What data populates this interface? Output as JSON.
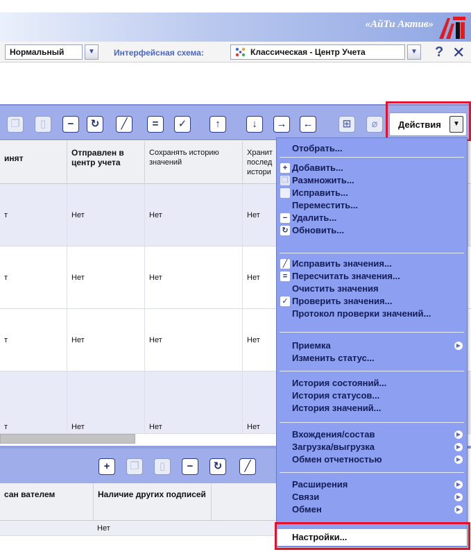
{
  "brand": {
    "name": "«АйТи Актив»"
  },
  "scheme_bar": {
    "mode": "Нормальный",
    "scheme_label": "Интерфейсная схема:",
    "scheme_value": "Классическая - Центр Учета",
    "help": "?",
    "close": "✕"
  },
  "toolbar": {
    "buttons": [
      "copy-icon",
      "new-doc-icon",
      "minus-icon",
      "refresh-icon",
      "pencil-icon",
      "equals-icon",
      "check-icon",
      "arrow-up-icon",
      "arrow-down-icon",
      "arrow-right-icon",
      "arrow-left-icon",
      "excel-icon",
      "attach-icon"
    ],
    "actions_label": "Действия"
  },
  "grid": {
    "columns": [
      "инят",
      "Отправлен в центр учета",
      "Сохранять историю значений",
      "Хранит послед истори"
    ],
    "rows": [
      [
        "т",
        "Нет",
        "Нет",
        "Нет"
      ],
      [
        "т",
        "Нет",
        "Нет",
        "Нет"
      ],
      [
        "т",
        "Нет",
        "Нет",
        "Нет"
      ],
      [
        "т",
        "Нет",
        "Нет",
        "Нет"
      ]
    ]
  },
  "grid2": {
    "columns": [
      "сан вателем",
      "Наличие других подписей"
    ],
    "row_value": "Нет"
  },
  "menu": {
    "items": [
      {
        "label": "Отобрать...",
        "icon": ""
      },
      {
        "label": "Добавить...",
        "icon": "plus"
      },
      {
        "label": "Размножить...",
        "icon": "copy"
      },
      {
        "label": "Исправить...",
        "icon": "doc"
      },
      {
        "label": "Переместить...",
        "icon": ""
      },
      {
        "label": "Удалить...",
        "icon": "minus"
      },
      {
        "label": "Обновить...",
        "icon": "refresh"
      },
      {
        "label": "Исправить значения...",
        "icon": "pencil"
      },
      {
        "label": "Пересчитать значения...",
        "icon": "equals"
      },
      {
        "label": "Очистить значения",
        "icon": ""
      },
      {
        "label": "Проверить значения...",
        "icon": "check"
      },
      {
        "label": "Протокол проверки значений...",
        "icon": ""
      },
      {
        "label": "Приемка",
        "icon": "",
        "submenu": true
      },
      {
        "label": "Изменить статус...",
        "icon": ""
      },
      {
        "label": "История состояний...",
        "icon": ""
      },
      {
        "label": "История статусов...",
        "icon": ""
      },
      {
        "label": "История значений...",
        "icon": ""
      },
      {
        "label": "Вхождения/состав",
        "icon": "",
        "submenu": true
      },
      {
        "label": "Загрузка/выгрузка",
        "icon": "",
        "submenu": true
      },
      {
        "label": "Обмен отчетностью",
        "icon": "",
        "submenu": true
      },
      {
        "label": "Расширения",
        "icon": "",
        "submenu": true
      },
      {
        "label": "Связи",
        "icon": "",
        "submenu": true
      },
      {
        "label": "Обмен",
        "icon": "",
        "submenu": true
      }
    ],
    "settings_label": "Настройки..."
  },
  "colors": {
    "toolbar": "#9faeea",
    "menu": "#8d9ff0",
    "highlight": "#e3112b",
    "menu_text": "#131c55"
  }
}
